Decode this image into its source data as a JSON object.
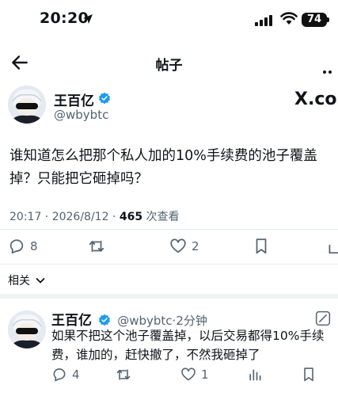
{
  "status_bar": {
    "time": "20:20",
    "battery": "74"
  },
  "nav": {
    "title": "帖子"
  },
  "post": {
    "author_name": "王百亿",
    "author_handle": "@wbybtc",
    "x_logo_text": "X.con",
    "text": "谁知道怎么把那个私人加的10%手续费的池子覆盖掉？只能把它砸掉吗？",
    "time": "20:17 · 2026/8/12 · ",
    "views_count": "465",
    "views_label": " 次查看",
    "replies": "8",
    "likes": "2"
  },
  "related_label": "相关",
  "reply": {
    "author_name": "王百亿",
    "author_handle": "@wbybtc",
    "time": "·2分钟",
    "text": "如果不把这个池子覆盖掉，以后交易都得10%手续费，谁加的，赶快撤了，不然我砸掉了",
    "replies": "4",
    "likes": "1"
  },
  "colors": {
    "verified": "#1d9bf0",
    "muted": "#536471",
    "text": "#0f1419"
  }
}
